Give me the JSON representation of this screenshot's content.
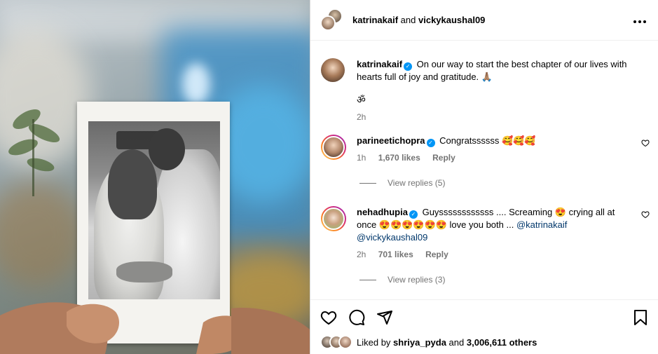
{
  "header": {
    "user1": "katrinakaif",
    "and": "and",
    "user2": "vickykaushal09",
    "more_icon": "more-horizontal-icon"
  },
  "caption": {
    "username": "katrinakaif",
    "text": "On our way to start the best chapter of our lives with hearts full of joy and gratitude. 🙏🏽",
    "om": "ॐ",
    "time": "2h"
  },
  "comments": [
    {
      "username": "parineetichopra",
      "text": "Congratssssss 🥰🥰🥰",
      "time": "1h",
      "likes": "1,670 likes",
      "reply": "Reply",
      "view_replies": "View replies (5)"
    },
    {
      "username": "nehadhupia",
      "text_before": "Guyssssssssssss .... Screaming 😍 crying all at once 😍😍😍😍😍😍 love you both ... ",
      "mention1": "@katrinakaif",
      "mention2": "@vickykaushal09",
      "time": "2h",
      "likes": "701 likes",
      "reply": "Reply",
      "view_replies": "View replies (3)"
    }
  ],
  "likes_line": {
    "prefix": "Liked by",
    "user": "shriya_pyda",
    "and": "and",
    "count": "3,006,611 others"
  },
  "colors": {
    "verified": "#0095f6",
    "meta": "#737373",
    "mention": "#00376b"
  }
}
